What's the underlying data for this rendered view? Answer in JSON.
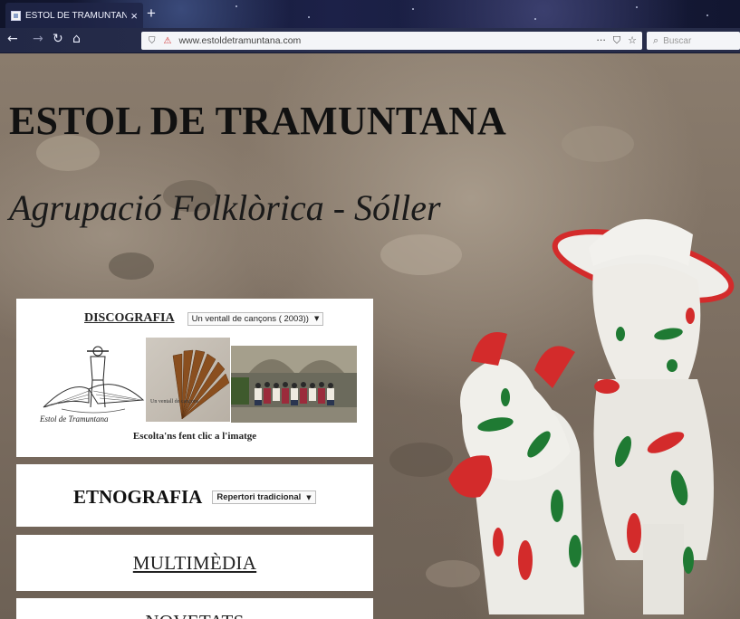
{
  "browser": {
    "tab_title": "ESTOL DE TRAMUNTANA",
    "tab_close": "×",
    "new_tab": "+",
    "url": "www.estoldetramuntana.com",
    "page_actions": "···",
    "search_placeholder": "Buscar"
  },
  "site": {
    "title": "ESTOL DE TRAMUNTANA",
    "subtitle": "Agrupació Folklòrica - Sóller"
  },
  "discografia": {
    "title": "DISCOGRAFIA",
    "select_value": "Un ventall de cançons ( 2003))",
    "logo_caption": "Estol de Tramuntana",
    "cd_caption": "Un ventall de cançons",
    "caption": "Escolta'ns fent clic a l'imatge"
  },
  "etnografia": {
    "title": "ETNOGRAFIA",
    "select_value": "Repertori tradicional"
  },
  "multimedia": {
    "title": "MULTIMÈDIA"
  },
  "novetats": {
    "title": "NOVETATS"
  },
  "colors": {
    "tabbar": "#1c2148",
    "panel": "#ffffff",
    "figurine_red": "#d32b2b",
    "figurine_green": "#1f7a33"
  }
}
